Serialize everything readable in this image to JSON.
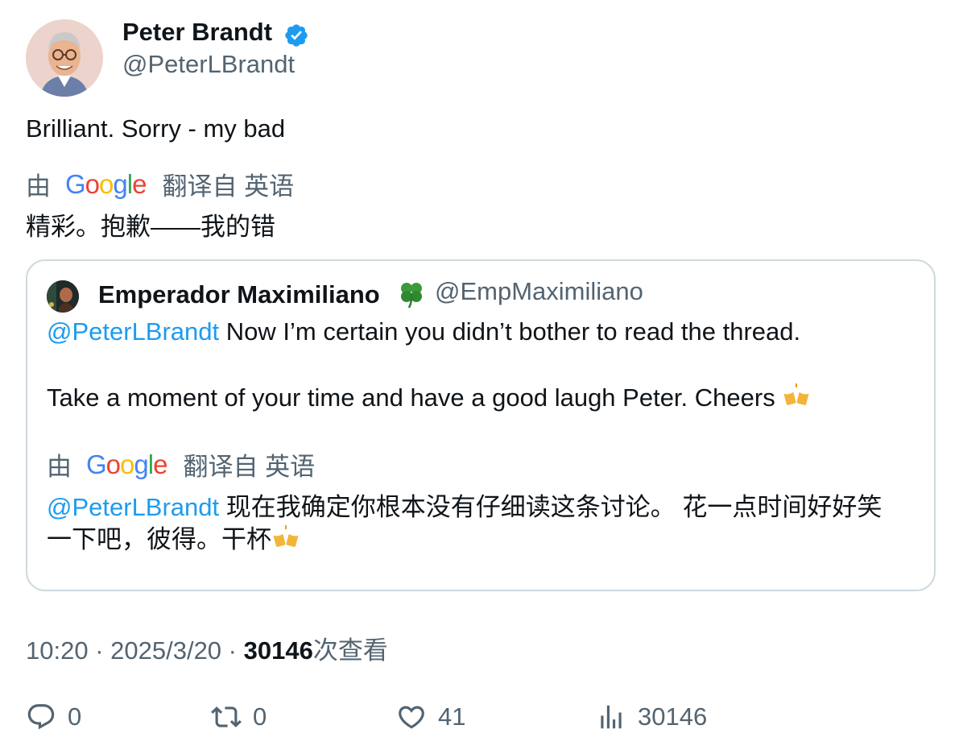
{
  "tweet": {
    "author": {
      "name": "Peter Brandt",
      "handle": "@PeterLBrandt",
      "verified": true,
      "verified_color": "#1d9bf0"
    },
    "text": "Brilliant. Sorry - my bad",
    "translation": {
      "by_label": "由",
      "provider": "Google",
      "from_label": "翻译自 英语",
      "text": "精彩。抱歉——我的错"
    },
    "quoted": {
      "author_name": "Emperador Maximiliano",
      "author_emoji": "clover-icon",
      "handle": "@EmpMaximiliano",
      "mention": "@PeterLBrandt",
      "line1": " Now I’m certain you didn’t bother to read the thread.",
      "line2": "Take a moment of your time and have a good laugh Peter. Cheers ",
      "translation": {
        "by_label": "由",
        "provider": "Google",
        "from_label": "翻译自 英语",
        "mention": "@PeterLBrandt",
        "line1": " 现在我确定你根本没有仔细读这条讨论。 花一点时间好好笑",
        "line2": "一下吧，彼得。干杯"
      }
    },
    "meta": {
      "time": "10:20",
      "sep1": " · ",
      "date": "2025/3/20",
      "sep2": " · ",
      "views_count": "30146",
      "views_label": "次查看"
    },
    "actions": {
      "replies": "0",
      "retweets": "0",
      "likes": "41",
      "views": "30146"
    }
  },
  "colors": {
    "text": "#0f1419",
    "secondary": "#536471",
    "link": "#1d9bf0",
    "border": "#cfd9de"
  }
}
